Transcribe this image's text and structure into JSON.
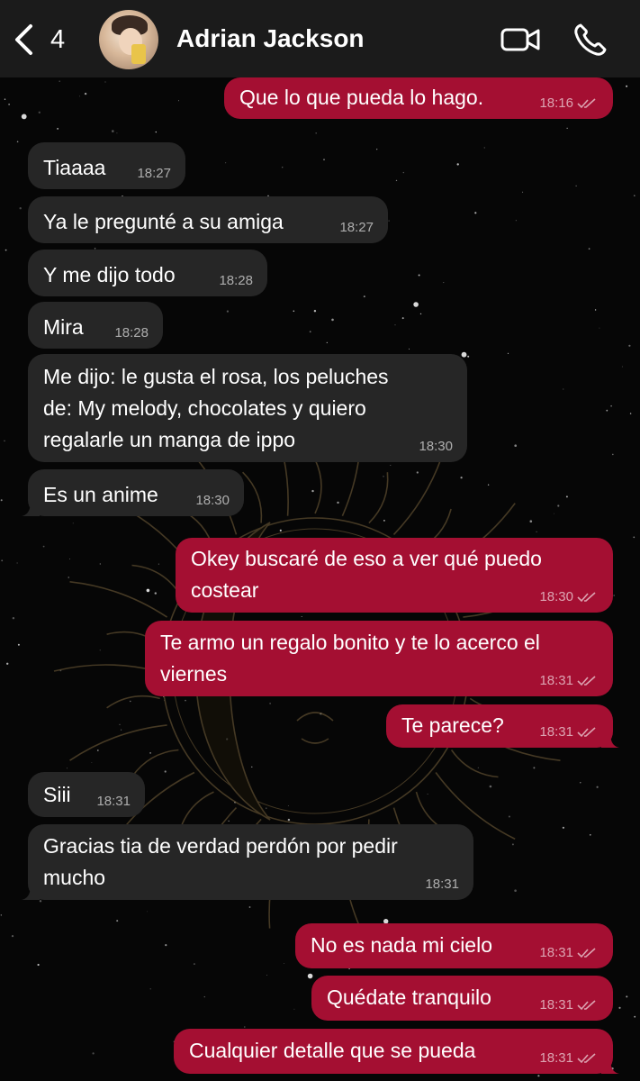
{
  "header": {
    "unread_count": "4",
    "contact_name": "Adrian Jackson",
    "back_icon": "chevron-left-icon",
    "video_icon": "video-camera-icon",
    "call_icon": "phone-icon"
  },
  "colors": {
    "incoming_bubble": "#262626",
    "outgoing_bubble": "#a40f32",
    "header_bg": "#1b1b1b"
  },
  "messages": [
    {
      "dir": "out",
      "text": [
        "Que lo que pueda lo hago."
      ],
      "time": "18:16",
      "ticks": true
    },
    {
      "dir": "in",
      "text": [
        "Tiaaaa"
      ],
      "time": "18:27"
    },
    {
      "dir": "in",
      "text": [
        "Ya le pregunté a su amiga"
      ],
      "time": "18:27"
    },
    {
      "dir": "in",
      "text": [
        "Y me dijo todo"
      ],
      "time": "18:28"
    },
    {
      "dir": "in",
      "text": [
        "Mira"
      ],
      "time": "18:28"
    },
    {
      "dir": "in",
      "text": [
        "Me dijo: le gusta el rosa,  los peluches",
        "de: My melody, chocolates y quiero",
        "regalarle un manga de ippo"
      ],
      "time": "18:30"
    },
    {
      "dir": "in",
      "text": [
        "Es un anime"
      ],
      "time": "18:30"
    },
    {
      "dir": "out",
      "text": [
        "Okey buscaré de eso a ver qué puedo",
        "costear"
      ],
      "time": "18:30",
      "ticks": true
    },
    {
      "dir": "out",
      "text": [
        "Te armo un regalo bonito y te lo acerco el",
        "viernes"
      ],
      "time": "18:31",
      "ticks": true
    },
    {
      "dir": "out",
      "text": [
        "Te parece?"
      ],
      "time": "18:31",
      "ticks": true
    },
    {
      "dir": "in",
      "text": [
        "Siii"
      ],
      "time": "18:31"
    },
    {
      "dir": "in",
      "text": [
        "Gracias tia de verdad perdón por pedir",
        "mucho"
      ],
      "time": "18:31"
    },
    {
      "dir": "out",
      "text": [
        "No es nada mi cielo"
      ],
      "time": "18:31",
      "ticks": true
    },
    {
      "dir": "out",
      "text": [
        "Quédate tranquilo"
      ],
      "time": "18:31",
      "ticks": true
    },
    {
      "dir": "out",
      "text": [
        "Cualquier detalle que se pueda"
      ],
      "time": "18:31",
      "ticks": true
    }
  ]
}
